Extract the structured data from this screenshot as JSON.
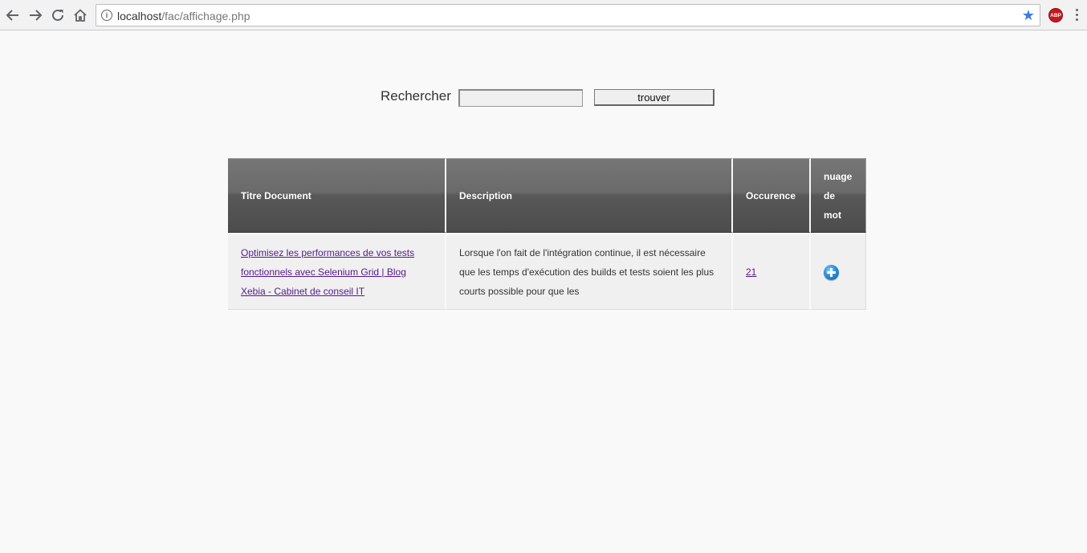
{
  "browser": {
    "url_host": "localhost",
    "url_path": "/fac/affichage.php",
    "extension_badge": "ABP"
  },
  "search": {
    "label": "Rechercher",
    "input_value": "",
    "button_label": "trouver"
  },
  "table": {
    "headers": {
      "title": "Titre Document",
      "description": "Description",
      "occurrence": "Occurence",
      "cloud": "nuage de mot"
    },
    "rows": [
      {
        "title": "Optimisez les performances de vos tests fonctionnels avec Selenium Grid | Blog Xebia - Cabinet de conseil IT",
        "description": "Lorsque l'on fait de l'intégration continue, il est nécessaire que les temps d'exécution des builds et tests soient les plus courts possible pour que les",
        "occurrence": "21",
        "cloud_icon": "plus-circle-icon"
      }
    ]
  },
  "colors": {
    "link": "#551a8b",
    "header_bg": "#5a5a5a",
    "bookmark_star": "#3b7be8",
    "abp_red": "#c8181e"
  }
}
